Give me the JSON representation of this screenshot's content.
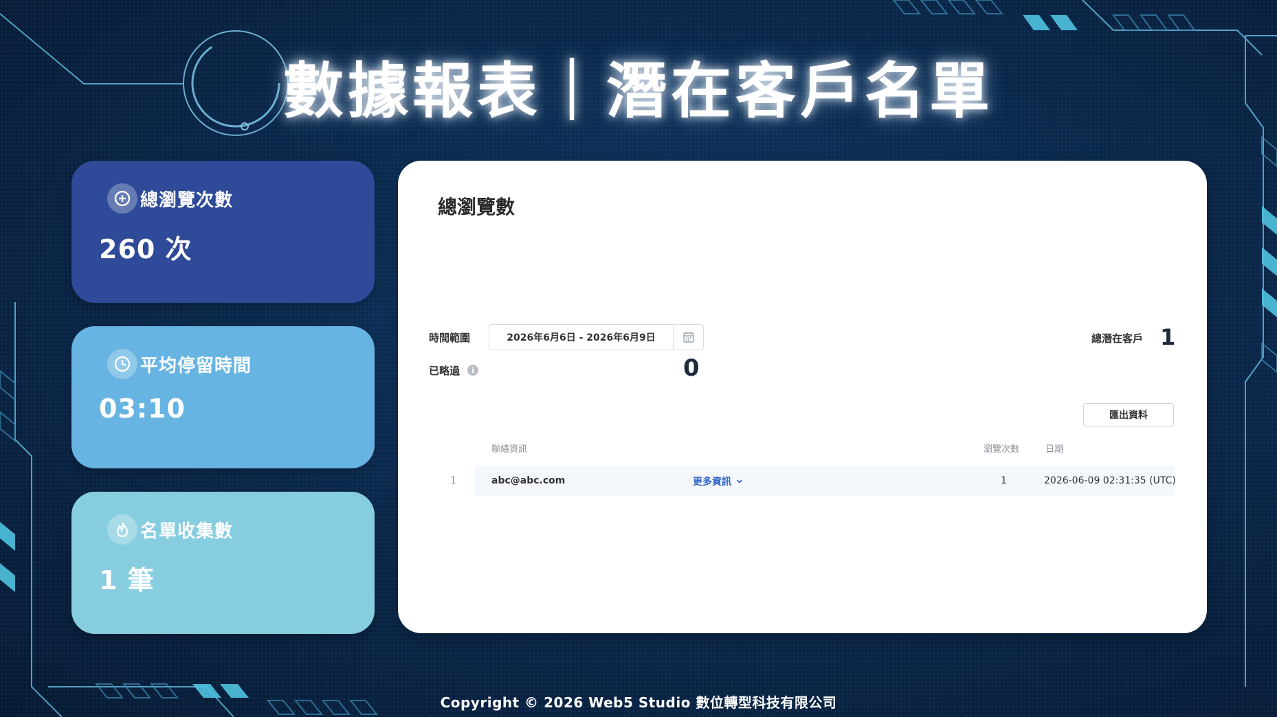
{
  "header": {
    "title": "數據報表｜潛在客戶名單"
  },
  "stats": [
    {
      "title": "總瀏覽次數",
      "value": "260 次",
      "icon": "plus-circle-icon",
      "color": "#2e4a98"
    },
    {
      "title": "平均停留時間",
      "value": "03:10",
      "icon": "clock-icon",
      "color": "#67b4e3"
    },
    {
      "title": "名單收集數",
      "value": "1 筆",
      "icon": "flame-icon",
      "color": "#86cde0"
    }
  ],
  "panel": {
    "title": "總瀏覽數",
    "time_range_label": "時間範圍",
    "date_range": "2026年6月6日 - 2026年6月9日",
    "skipped_label": "已略過",
    "skipped_count": "0",
    "total_leads_label": "總潛在客戶",
    "total_leads_count": "1",
    "export_label": "匯出資料",
    "table": {
      "headers": {
        "contact": "聯絡資訊",
        "views": "瀏覽次數",
        "date": "日期"
      },
      "rows": [
        {
          "num": "1",
          "email": "abc@abc.com",
          "more": "更多資訊",
          "views": "1",
          "date": "2026-06-09 02:31:35 (UTC)"
        }
      ]
    }
  },
  "footer": {
    "copyright": "Copyright © 2026 Web5 Studio 數位轉型科技有限公司"
  }
}
